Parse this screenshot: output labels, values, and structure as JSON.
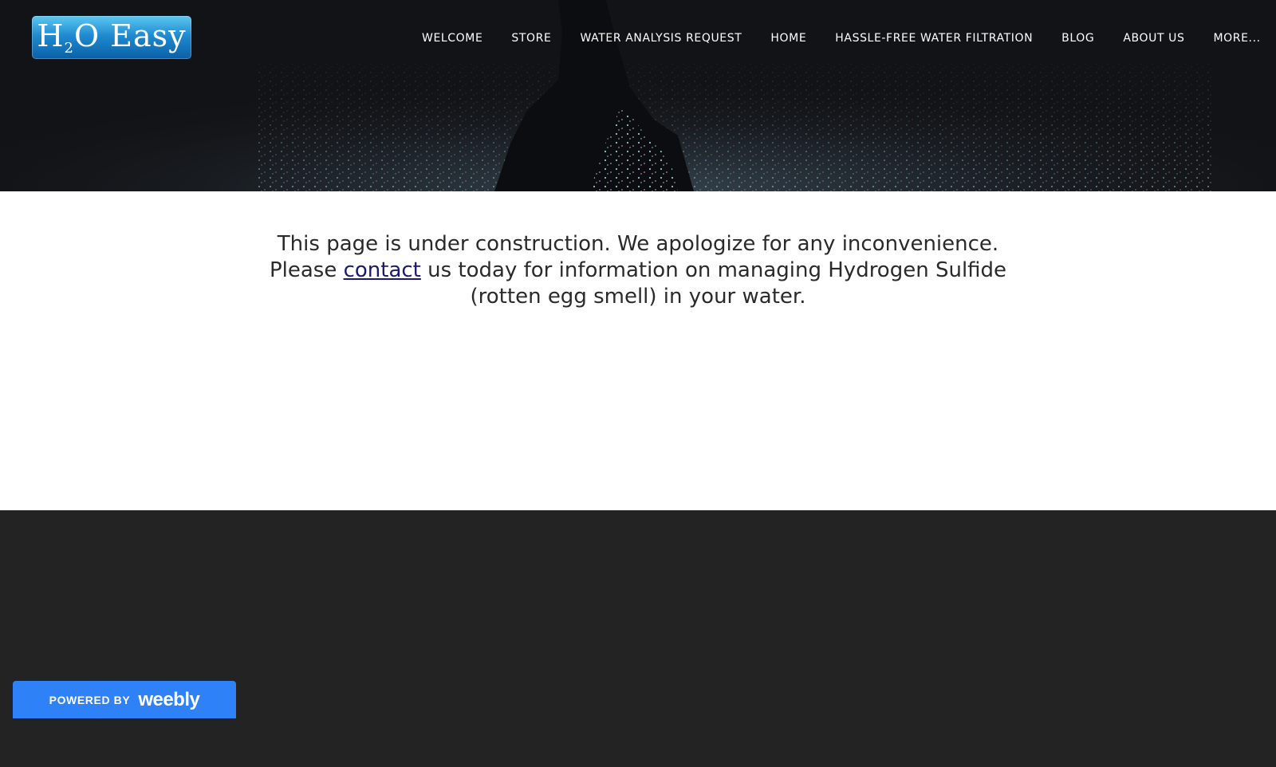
{
  "header": {
    "logo": {
      "main_text": "H",
      "subscript": "2",
      "rest_text": "O Easy"
    },
    "nav": [
      {
        "label": "WELCOME"
      },
      {
        "label": "STORE"
      },
      {
        "label": "WATER ANALYSIS REQUEST"
      },
      {
        "label": "HOME"
      },
      {
        "label": "HASSLE-FREE WATER FILTRATION"
      },
      {
        "label": "BLOG"
      },
      {
        "label": "ABOUT US"
      },
      {
        "label": "MORE..."
      }
    ]
  },
  "main": {
    "line1": "This page is under construction. We apologize for any inconvenience.",
    "please": "Please ",
    "contact_link": "contact",
    "line2_rest": " us today for information on managing Hydrogen Sulfide (rotten egg smell) in your water."
  },
  "footer": {
    "badge_prefix": "POWERED BY",
    "badge_brand": "weebly"
  },
  "colors": {
    "banner_bg": "#121316",
    "content_bg": "#ffffff",
    "footer_bg": "#232323",
    "badge_bg": "#2f81f7",
    "link": "#1a1a6e"
  }
}
